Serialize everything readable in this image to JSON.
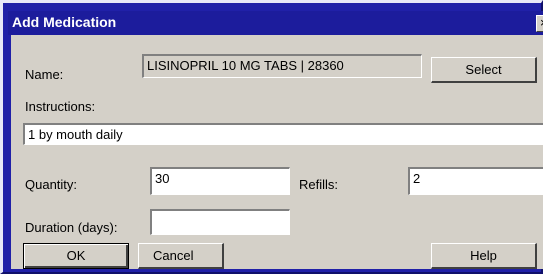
{
  "window": {
    "title": "Add Medication",
    "close_glyph": "×"
  },
  "form": {
    "name_label": "Name:",
    "name_value": "LISINOPRIL 10 MG TABS | 28360",
    "select_label": "Select",
    "instructions_label": "Instructions:",
    "instructions_value": "1 by mouth daily",
    "quantity_label": "Quantity:",
    "quantity_value": "30",
    "refills_label": "Refills:",
    "refills_value": "2",
    "duration_label": "Duration (days):",
    "duration_value": ""
  },
  "buttons": {
    "ok": "OK",
    "cancel": "Cancel",
    "help": "Help"
  },
  "colors": {
    "desktop": "#2020a8",
    "title_bar": "#1c1c9c",
    "dialog_face": "#d4d0c8"
  }
}
